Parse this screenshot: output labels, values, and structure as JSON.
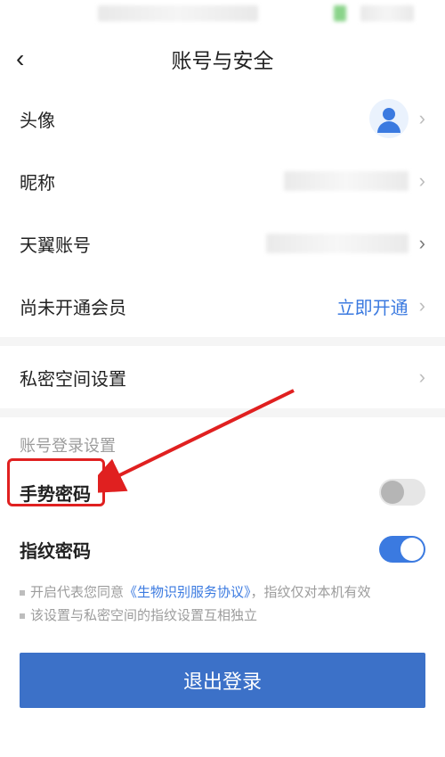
{
  "header": {
    "back_icon": "‹",
    "title": "账号与安全"
  },
  "rows": {
    "avatar_label": "头像",
    "nickname_label": "昵称",
    "account_label": "天翼账号",
    "member_label": "尚未开通会员",
    "member_action": "立即开通",
    "private_space_label": "私密空间设置"
  },
  "login_section": {
    "header": "账号登录设置",
    "gesture_label": "手势密码",
    "fingerprint_label": "指纹密码"
  },
  "notes": {
    "line1_prefix": "开启代表您同意",
    "line1_agreement": "《生物识别服务协议》",
    "line1_suffix": "，指纹仅对本机有效",
    "line2": "该设置与私密空间的指纹设置互相独立"
  },
  "logout": {
    "label": "退出登录"
  }
}
